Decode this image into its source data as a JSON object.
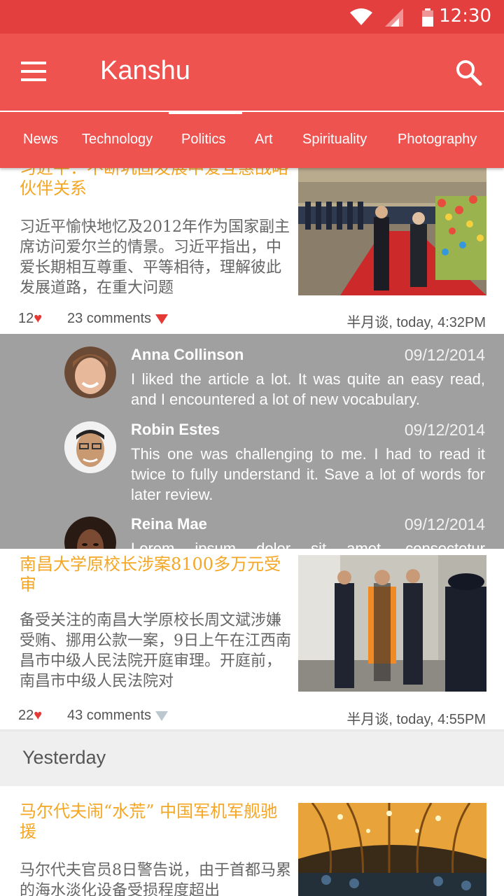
{
  "status_bar": {
    "time": "12:30",
    "icons": [
      "wifi-icon",
      "signal-icon",
      "battery-icon"
    ]
  },
  "app_bar": {
    "title": "Kanshu",
    "icons": [
      "menu-icon",
      "search-icon"
    ]
  },
  "tabs": [
    {
      "label": "News"
    },
    {
      "label": "Technology"
    },
    {
      "label": "Politics",
      "active": true
    },
    {
      "label": "Art"
    },
    {
      "label": "Spirituality"
    },
    {
      "label": "Photography"
    }
  ],
  "articles": [
    {
      "title": "习近平：不断巩固发展中爱互惠战略伙伴关系",
      "body": "习近平愉快地忆及2012年作为国家副主席访问爱尔兰的情景。习近平指出，中爱长期相互尊重、平等相待，理解彼此发展道路，在重大问题",
      "likes": "12",
      "comments": "23 comments",
      "source": "半月谈, today, 4:32PM"
    },
    {
      "title": "南昌大学原校长涉案8100多万元受审",
      "body": "备受关注的南昌大学原校长周文斌涉嫌受贿、挪用公款一案，9日上午在江西南昌市中级人民法院开庭审理。开庭前，南昌市中级人民法院对",
      "likes": "22",
      "comments": "43 comments",
      "source": "半月谈, today, 4:55PM"
    },
    {
      "title": "马尔代夫闹“水荒” 中国军机军舰驰援",
      "body": "马尔代夫官员8日警告说，由于首都马累的海水淡化设备受损程度超出"
    }
  ],
  "comments": [
    {
      "name": "Anna Collinson",
      "date": "09/12/2014",
      "text": "I liked the article a lot. It was quite an easy read, and I encountered a lot of new vocabulary."
    },
    {
      "name": "Robin Estes",
      "date": "09/12/2014",
      "text": "This one was challenging to me. I had to read it twice to fully understand it. Save a lot of words for later review."
    },
    {
      "name": "Reina Mae",
      "date": "09/12/2014",
      "text": "Lorem ipsum dolor sit amet, consectetur"
    }
  ],
  "section": {
    "label": "Yesterday"
  },
  "colors": {
    "primary": "#ef5350",
    "status_bar": "#e43f3f",
    "title_accent": "#f5a623",
    "heart": "#e53935",
    "comments_panel": "#a0a0a0"
  }
}
